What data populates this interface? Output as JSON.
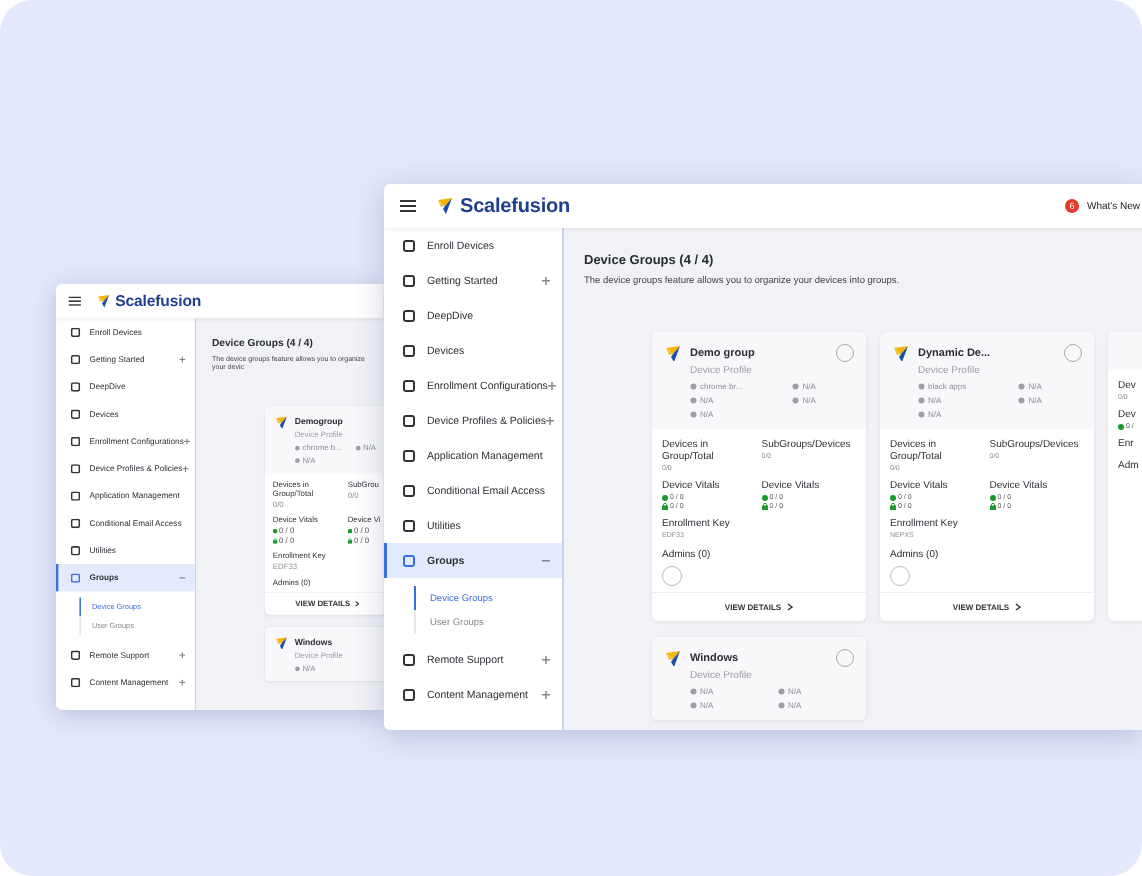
{
  "windows": [
    {
      "header": {
        "brand": "Scalefusion"
      },
      "sidebar": {
        "items": [
          {
            "label": "Enroll Devices",
            "expandable": false,
            "expanded": false,
            "selected": false
          },
          {
            "label": "Getting Started",
            "expandable": true,
            "expanded": false,
            "selected": false
          },
          {
            "label": "DeepDive",
            "expandable": false,
            "expanded": false,
            "selected": false
          },
          {
            "label": "Devices",
            "expandable": false,
            "expanded": false,
            "selected": false
          },
          {
            "label": "Enrollment Configurations",
            "expandable": true,
            "expanded": false,
            "selected": false
          },
          {
            "label": "Device Profiles & Policies",
            "expandable": true,
            "expanded": false,
            "selected": false
          },
          {
            "label": "Application Management",
            "expandable": false,
            "expanded": false,
            "selected": false
          },
          {
            "label": "Conditional Email Access",
            "expandable": false,
            "expanded": false,
            "selected": false
          },
          {
            "label": "Utilities",
            "expandable": false,
            "expanded": false,
            "selected": false
          },
          {
            "label": "Groups",
            "expandable": true,
            "expanded": true,
            "selected": true,
            "children": [
              {
                "label": "Device Groups",
                "selected": true
              },
              {
                "label": "User Groups",
                "selected": false
              }
            ]
          },
          {
            "label": "Remote Support",
            "expandable": true,
            "expanded": false,
            "selected": false
          },
          {
            "label": "Content Management",
            "expandable": true,
            "expanded": false,
            "selected": false
          }
        ]
      },
      "main": {
        "title": "Device Groups (4 / 4)",
        "description": "The device groups feature allows you to organize your devic",
        "cards": [
          {
            "cut": true,
            "name": "Demogroup",
            "subtitle": "Device Profile",
            "platforms": [
              "chrome b...",
              "N/A",
              "N/A"
            ],
            "stats": [
              {
                "label": "Devices in Group/Total",
                "value": "0/0"
              },
              {
                "label": "SubGrou",
                "value": "0/0"
              },
              {
                "label": "Device Vitals",
                "lines": [
                  "0 / 0",
                  "0 / 0"
                ]
              },
              {
                "label": "Device Vi",
                "lines": [
                  "0 / 0",
                  "0 / 0"
                ]
              },
              {
                "label": "Enrollment Key",
                "value": "EDF33"
              }
            ],
            "admins": "Admins (0)",
            "action": "VIEW DETAILS"
          },
          {
            "cut": true,
            "name": "Windows",
            "subtitle": "Device Profile",
            "platforms": [
              "N/A"
            ]
          }
        ]
      }
    },
    {
      "header": {
        "brand": "Scalefusion",
        "badge": "6",
        "whats_new": "What's New"
      },
      "sidebar": {
        "items": [
          {
            "label": "Enroll Devices",
            "expandable": false,
            "expanded": false,
            "selected": false
          },
          {
            "label": "Getting Started",
            "expandable": true,
            "expanded": false,
            "selected": false
          },
          {
            "label": "DeepDive",
            "expandable": false,
            "expanded": false,
            "selected": false
          },
          {
            "label": "Devices",
            "expandable": false,
            "expanded": false,
            "selected": false
          },
          {
            "label": "Enrollment Configurations",
            "expandable": true,
            "expanded": false,
            "selected": false
          },
          {
            "label": "Device Profiles & Policies",
            "expandable": true,
            "expanded": false,
            "selected": false
          },
          {
            "label": "Application Management",
            "expandable": false,
            "expanded": false,
            "selected": false
          },
          {
            "label": "Conditional Email Access",
            "expandable": false,
            "expanded": false,
            "selected": false
          },
          {
            "label": "Utilities",
            "expandable": false,
            "expanded": false,
            "selected": false
          },
          {
            "label": "Groups",
            "expandable": true,
            "expanded": true,
            "selected": true,
            "children": [
              {
                "label": "Device Groups",
                "selected": true
              },
              {
                "label": "User Groups",
                "selected": false
              }
            ]
          },
          {
            "label": "Remote Support",
            "expandable": true,
            "expanded": false,
            "selected": false
          },
          {
            "label": "Content Management",
            "expandable": true,
            "expanded": false,
            "selected": false
          }
        ]
      },
      "main": {
        "title": "Device Groups (4 / 4)",
        "description": "The device groups feature allows you to organize your devices into groups.",
        "cards": [
          {
            "cut": false,
            "name": "Demo group",
            "subtitle": "Device Profile",
            "platforms": [
              "chrome br...",
              "N/A",
              "N/A",
              "N/A",
              "N/A"
            ],
            "stats": [
              {
                "label": "Devices in Group/Total",
                "value": "0/0"
              },
              {
                "label": "SubGroups/Devices",
                "value": "0/0"
              },
              {
                "label": "Device Vitals",
                "lines": [
                  "0 / 0",
                  "0 / 0"
                ]
              },
              {
                "label": "Device Vitals",
                "lines": [
                  "0 / 0",
                  "0 / 0"
                ]
              },
              {
                "label": "Enrollment Key",
                "value": "EDF33"
              }
            ],
            "admins": "Admins (0)",
            "action": "VIEW DETAILS"
          },
          {
            "cut": false,
            "name": "Dynamic De...",
            "subtitle": "Device Profile",
            "platforms": [
              "black apps",
              "N/A",
              "N/A",
              "N/A",
              "N/A"
            ],
            "stats": [
              {
                "label": "Devices in Group/Total",
                "value": "0/0"
              },
              {
                "label": "SubGroups/Devices",
                "value": "0/0"
              },
              {
                "label": "Device Vitals",
                "lines": [
                  "0 / 0",
                  "0 / 0"
                ]
              },
              {
                "label": "Device Vitals",
                "lines": [
                  "0 / 0",
                  "0 / 0"
                ]
              },
              {
                "label": "Enrollment Key",
                "value": "NEPXS"
              }
            ],
            "admins": "Admins (0)",
            "action": "VIEW DETAILS"
          },
          {
            "cut": true,
            "stats": [
              {
                "label": "Dev",
                "value": "0/0"
              },
              {
                "label": "Dev",
                "lines": [
                  "0 /"
                ]
              },
              {
                "label": "Enr"
              }
            ],
            "admins": "Adm"
          },
          {
            "cut": false,
            "name": "Windows",
            "subtitle": "Device Profile",
            "platforms": [
              "N/A",
              "N/A",
              "N/A",
              "N/A"
            ]
          }
        ]
      }
    }
  ]
}
